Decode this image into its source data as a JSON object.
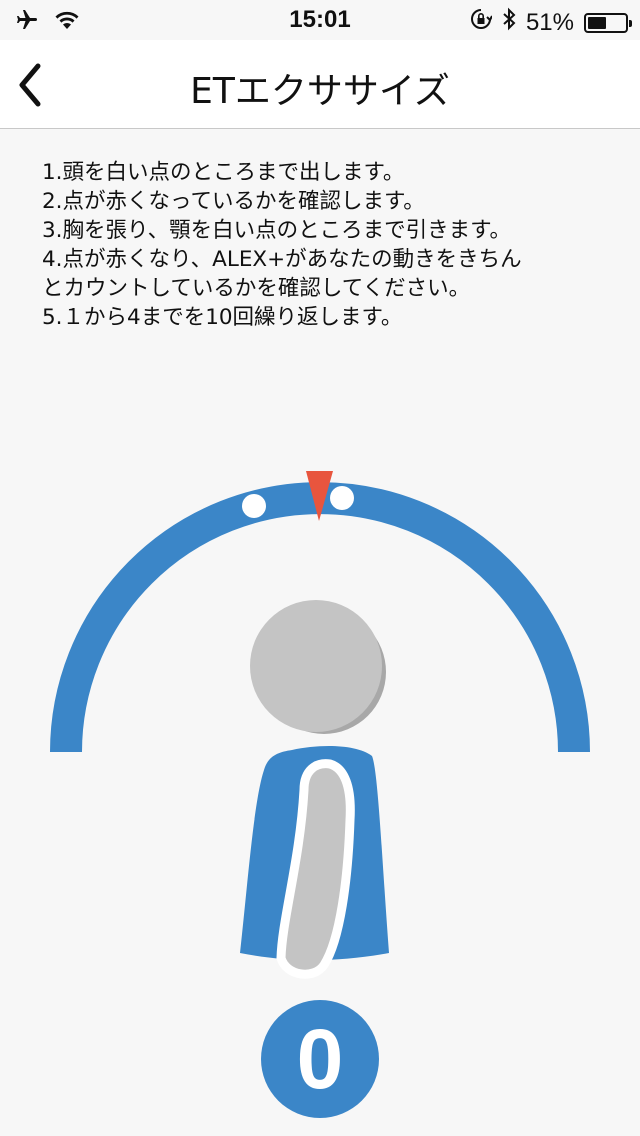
{
  "status_bar": {
    "time": "15:01",
    "battery_percent": "51%",
    "battery_level": 0.51,
    "icons": [
      "airplane-icon",
      "wifi-icon",
      "rotation-lock-icon",
      "bluetooth-icon",
      "battery-icon"
    ]
  },
  "nav": {
    "title": "ETエクササイズ",
    "back_icon": "chevron-left-icon"
  },
  "instructions": [
    "1.頭を白い点のところまで出します。",
    "2.点が赤くなっているかを確認します。",
    "3.胸を張り、顎を白い点のところまで引きます。",
    "4.点が赤くなり、ALEX+があなたの動きをきちん",
    "とカウントしているかを確認してください。",
    "5.１から4までを10回繰り返します。"
  ],
  "exercise": {
    "count": "0",
    "colors": {
      "arc": "#3b86c8",
      "indicator": "#e8553e",
      "dots": "#ffffff",
      "head": "#c4c4c4",
      "head_shadow": "#a8a8a8",
      "body": "#3b86c8",
      "arm": "#c4c4c4"
    }
  }
}
